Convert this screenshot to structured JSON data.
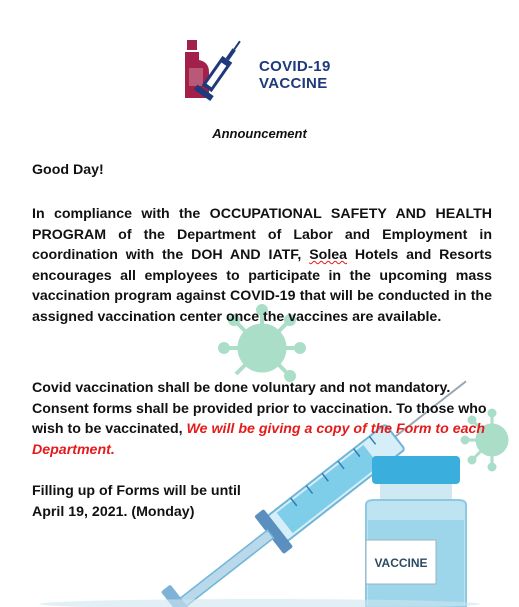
{
  "logo": {
    "line1": "COVID-19",
    "line2": "VACCINE",
    "icon": "syringe-vial-icon",
    "colors": {
      "accent": "#a3204a",
      "navy": "#1f3a7a"
    }
  },
  "heading": "Announcement",
  "greeting": "Good Day!",
  "paragraph1": {
    "before_name": "In compliance with the OCCUPATIONAL SAFETY AND HEALTH PROGRAM  of the Department of Labor and Employment  in coordination with the DOH AND IATF, ",
    "name": "Solea",
    "after_name": " Hotels and Resorts encourages all employees  to participate in the upcoming mass vaccination program against COVID-19 that will be conducted in the assigned vaccination center once the vaccines are available."
  },
  "paragraph2": {
    "text": "Covid vaccination shall be done voluntary and not mandatory. Consent forms shall be provided prior to vaccination. To those who wish to be vaccinated, ",
    "highlight": "We will be giving a copy of the Form to each Department.",
    "highlight_color": "#e51b1b"
  },
  "paragraph3": {
    "line1": "Filling up of Forms will be until",
    "line2": "April 19, 2021. (Monday)"
  },
  "illustration": {
    "vial_label": "VACCINE",
    "icons": [
      "virus-icon",
      "syringe-icon",
      "vaccine-vial-icon"
    ]
  }
}
